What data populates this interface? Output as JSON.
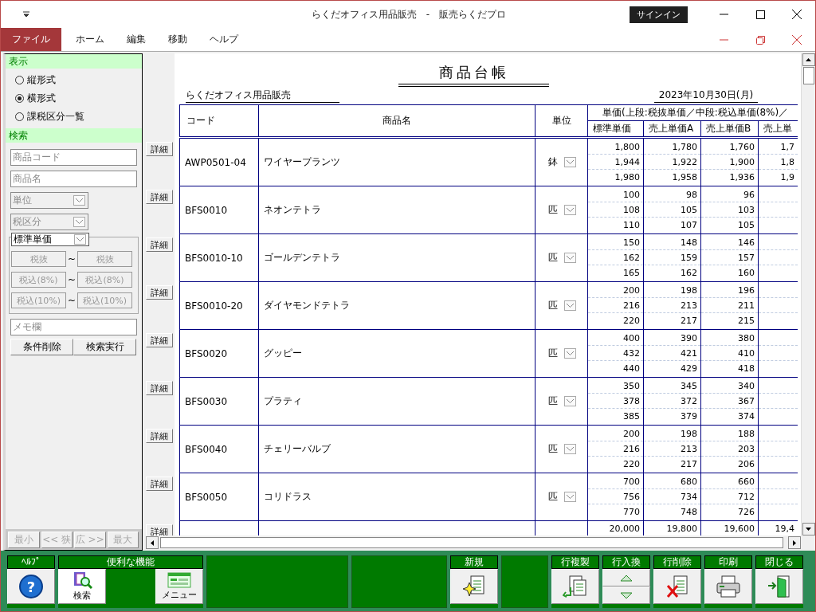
{
  "window": {
    "title": "らくだオフィス用品販売　-　販売らくだプロ",
    "sign_in": "サインイン"
  },
  "menu": [
    {
      "label": "ファイル",
      "selected": true
    },
    {
      "label": "ホーム",
      "selected": false
    },
    {
      "label": "編集",
      "selected": false
    },
    {
      "label": "移動",
      "selected": false
    },
    {
      "label": "ヘルプ",
      "selected": false
    }
  ],
  "display": {
    "heading": "表示",
    "options": [
      {
        "label": "縦形式",
        "selected": false
      },
      {
        "label": "横形式",
        "selected": true
      },
      {
        "label": "課税区分一覧",
        "selected": false
      }
    ]
  },
  "search": {
    "heading": "検索",
    "fields": [
      {
        "kind": "text",
        "placeholder": "商品コード"
      },
      {
        "kind": "text",
        "placeholder": "商品名"
      },
      {
        "kind": "select",
        "placeholder": "単位"
      },
      {
        "kind": "select",
        "placeholder": "税区分"
      }
    ],
    "price_type": "標準単価",
    "separator": "~",
    "ranges": [
      {
        "from": "税抜",
        "to": "税抜"
      },
      {
        "from": "税込(8%)",
        "to": "税込(8%)"
      },
      {
        "from": "税込(10%)",
        "to": "税込(10%)"
      }
    ],
    "memo_placeholder": "メモ欄",
    "buttons": [
      "条件削除",
      "検索実行"
    ]
  },
  "zoom_buttons": [
    {
      "label": "最小",
      "disabled": true
    },
    {
      "label": "<< 狭",
      "disabled": true
    },
    {
      "label": "広 >>",
      "disabled": true
    },
    {
      "label": "最大",
      "disabled": true
    }
  ],
  "report": {
    "title": "商品台帳",
    "company": "らくだオフィス用品販売",
    "date": "2023年10月30日(月)",
    "columns": {
      "code": "コード",
      "name": "商品名",
      "unit": "単位",
      "price_group": "単価(上段:税抜単価／中段:税込単価(8%)／",
      "prices": [
        "標準単価",
        "売上単価A",
        "売上単価B",
        "売上単"
      ]
    },
    "rows": [
      {
        "detail": "詳細",
        "code": "AWP0501-04",
        "name": "ワイヤープランツ",
        "unit": "鉢",
        "prices": [
          [
            "1,800",
            "1,780",
            "1,760",
            "1,7"
          ],
          [
            "1,944",
            "1,922",
            "1,900",
            "1,8"
          ],
          [
            "1,980",
            "1,958",
            "1,936",
            "1,9"
          ]
        ]
      },
      {
        "detail": "詳細",
        "code": "BFS0010",
        "name": "ネオンテトラ",
        "unit": "匹",
        "prices": [
          [
            "100",
            "98",
            "96"
          ],
          [
            "108",
            "105",
            "103"
          ],
          [
            "110",
            "107",
            "105"
          ]
        ]
      },
      {
        "detail": "詳細",
        "code": "BFS0010-10",
        "name": "ゴールデンテトラ",
        "unit": "匹",
        "prices": [
          [
            "150",
            "148",
            "146"
          ],
          [
            "162",
            "159",
            "157"
          ],
          [
            "165",
            "162",
            "160"
          ]
        ]
      },
      {
        "detail": "詳細",
        "code": "BFS0010-20",
        "name": "ダイヤモンドテトラ",
        "unit": "匹",
        "prices": [
          [
            "200",
            "198",
            "196"
          ],
          [
            "216",
            "213",
            "211"
          ],
          [
            "220",
            "217",
            "215"
          ]
        ]
      },
      {
        "detail": "詳細",
        "code": "BFS0020",
        "name": "グッピー",
        "unit": "匹",
        "prices": [
          [
            "400",
            "390",
            "380"
          ],
          [
            "432",
            "421",
            "410"
          ],
          [
            "440",
            "429",
            "418"
          ]
        ]
      },
      {
        "detail": "詳細",
        "code": "BFS0030",
        "name": "プラティ",
        "unit": "匹",
        "prices": [
          [
            "350",
            "345",
            "340"
          ],
          [
            "378",
            "372",
            "367"
          ],
          [
            "385",
            "379",
            "374"
          ]
        ]
      },
      {
        "detail": "詳細",
        "code": "BFS0040",
        "name": "チェリーバルブ",
        "unit": "匹",
        "prices": [
          [
            "200",
            "198",
            "188"
          ],
          [
            "216",
            "213",
            "203"
          ],
          [
            "220",
            "217",
            "206"
          ]
        ]
      },
      {
        "detail": "詳細",
        "code": "BFS0050",
        "name": "コリドラス",
        "unit": "匹",
        "prices": [
          [
            "700",
            "680",
            "660"
          ],
          [
            "756",
            "734",
            "712"
          ],
          [
            "770",
            "748",
            "726"
          ]
        ]
      },
      {
        "detail": "詳細",
        "prices": [
          [
            "20,000",
            "19,800",
            "19,600",
            "19,4"
          ]
        ]
      }
    ]
  },
  "toolbar": [
    {
      "kind": "help",
      "header": "ﾍﾙﾌﾟ",
      "icon_text": "?"
    },
    {
      "kind": "tools",
      "header": "便利な機能",
      "buttons": [
        {
          "kind": "search",
          "label": "検索",
          "selected": true
        },
        {
          "kind": "menu",
          "label": "メニュー",
          "selected": false
        }
      ]
    },
    {
      "kind": "blank"
    },
    {
      "kind": "blank"
    },
    {
      "kind": "new",
      "header": "新規"
    },
    {
      "kind": "blank"
    },
    {
      "kind": "copy",
      "header": "行複製"
    },
    {
      "kind": "swap",
      "header": "行入換"
    },
    {
      "kind": "delete",
      "header": "行削除"
    },
    {
      "kind": "print",
      "header": "印刷"
    },
    {
      "kind": "close",
      "header": "閉じる"
    }
  ]
}
